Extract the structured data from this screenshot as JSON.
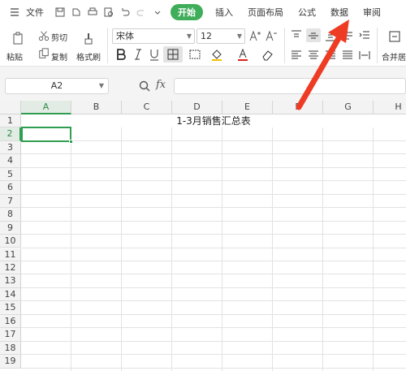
{
  "menu": {
    "file_label": "文件",
    "tabs": [
      {
        "label": "开始",
        "active": true
      },
      {
        "label": "插入"
      },
      {
        "label": "页面布局"
      },
      {
        "label": "公式"
      },
      {
        "label": "数据"
      },
      {
        "label": "审阅"
      }
    ]
  },
  "toolbar": {
    "paste_label": "粘贴",
    "cut_label": "剪切",
    "copy_label": "复制",
    "format_painter_label": "格式刷",
    "font_name": "宋体",
    "font_size": "12",
    "merge_label": "合并居"
  },
  "formula_bar": {
    "name_box": "A2",
    "fx_label": "fx"
  },
  "grid": {
    "columns": [
      "A",
      "B",
      "C",
      "D",
      "E",
      "F",
      "G",
      "H"
    ],
    "rows": [
      "1",
      "2",
      "3",
      "4",
      "5",
      "6",
      "7",
      "8",
      "9",
      "10",
      "11",
      "12",
      "13",
      "14",
      "15",
      "16",
      "17",
      "18",
      "19"
    ],
    "selected_cell": "A2",
    "title_text": "1-3月销售汇总表"
  },
  "colors": {
    "accent": "#3fad5a",
    "selection": "#2f9e50",
    "arrow": "#ee3b24"
  }
}
